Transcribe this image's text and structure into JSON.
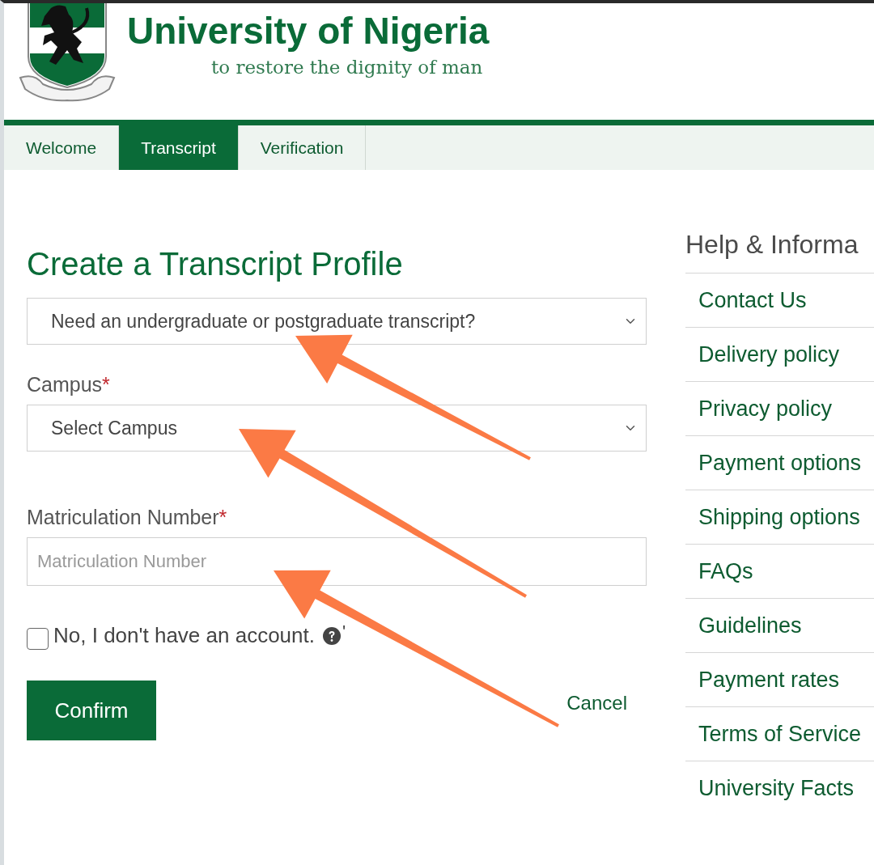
{
  "header": {
    "title": "University of Nigeria",
    "motto": "to restore the dignity of man"
  },
  "tabs": [
    {
      "label": "Welcome",
      "selected": false
    },
    {
      "label": "Transcript",
      "selected": true
    },
    {
      "label": "Verification",
      "selected": false
    }
  ],
  "form": {
    "title": "Create a Transcript Profile",
    "type_select": {
      "value": "Need an undergraduate or postgraduate transcript?"
    },
    "campus": {
      "label": "Campus",
      "required_mark": "*",
      "value": "Select Campus"
    },
    "matric": {
      "label": "Matriculation Number",
      "required_mark": "*",
      "placeholder": "Matriculation Number"
    },
    "no_account": {
      "label": "No, I don't have an account.",
      "checked": false,
      "suffix": "'"
    },
    "buttons": [
      {
        "label": "Confirm",
        "kind": "primary"
      },
      {
        "label": "Cancel",
        "kind": "link"
      }
    ]
  },
  "sidebar": {
    "title": "Help & Informa",
    "items": [
      "Contact Us",
      "Delivery policy",
      "Privacy policy",
      "Payment options",
      "Shipping options",
      "FAQs",
      "Guidelines",
      "Payment rates",
      "Terms of Service",
      "University Facts"
    ]
  },
  "annotations": [
    {
      "kind": "arrow"
    },
    {
      "kind": "arrow"
    },
    {
      "kind": "arrow"
    }
  ]
}
